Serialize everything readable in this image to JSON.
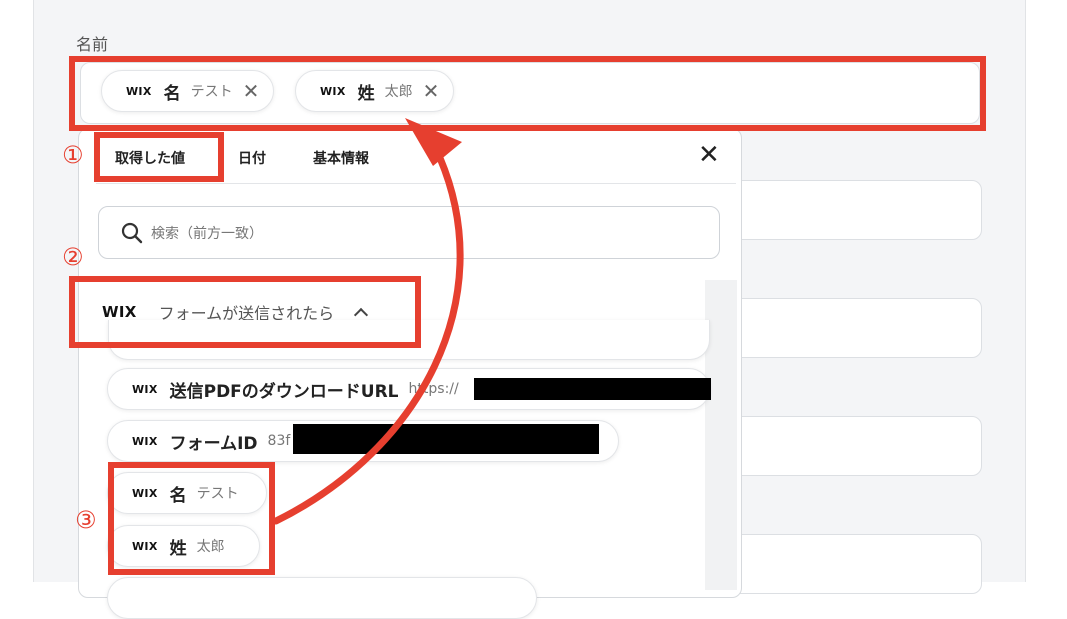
{
  "field": {
    "label": "名前",
    "chips": [
      {
        "brand": "WIX",
        "name": "名",
        "value": "テスト",
        "remove": "✕"
      },
      {
        "brand": "WIX",
        "name": "姓",
        "value": "太郎",
        "remove": "✕"
      }
    ]
  },
  "popup": {
    "tabs": [
      "取得した値",
      "日付",
      "基本情報"
    ],
    "close": "✕",
    "search_placeholder": "検索（前方一致）",
    "group": {
      "brand": "WIX",
      "title": "フォームが送信されたら",
      "chevron": "^"
    },
    "items": [
      {
        "brand": "WIX",
        "name": "送信PDFのダウンロードURL",
        "value": "https://"
      },
      {
        "brand": "WIX",
        "name": "フォームID",
        "value": "83f"
      },
      {
        "brand": "WIX",
        "name": "名",
        "value": "テスト"
      },
      {
        "brand": "WIX",
        "name": "姓",
        "value": "太郎"
      }
    ]
  },
  "annotations": {
    "step1": "①",
    "step2": "②",
    "step3": "③",
    "color": "#e63f2f"
  }
}
